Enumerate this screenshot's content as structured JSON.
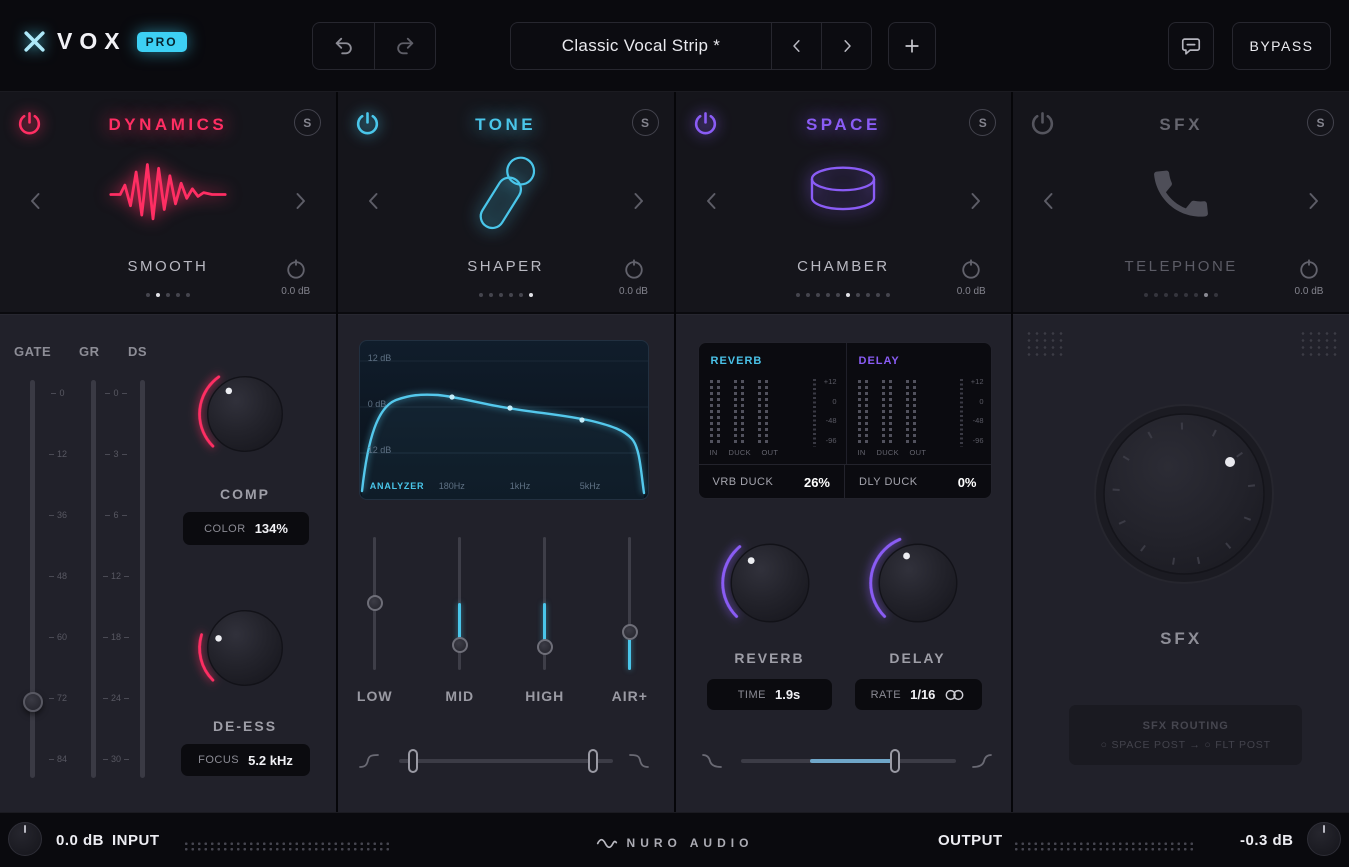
{
  "header": {
    "brand": "VOX",
    "badge": "PRO",
    "preset_name": "Classic Vocal Strip *",
    "bypass_label": "BYPASS"
  },
  "solo_label": "S",
  "modules": [
    {
      "title": "DYNAMICS",
      "preset": "SMOOTH",
      "gain": "0.0 dB",
      "accent": "#ff2e63",
      "dots": {
        "count": 5,
        "active": 1
      }
    },
    {
      "title": "TONE",
      "preset": "SHAPER",
      "gain": "0.0 dB",
      "accent": "#4ac6ea",
      "dots": {
        "count": 6,
        "active": 5
      }
    },
    {
      "title": "SPACE",
      "preset": "CHAMBER",
      "gain": "0.0 dB",
      "accent": "#8a5cf5",
      "dots": {
        "count": 10,
        "active": 5
      }
    },
    {
      "title": "SFX",
      "preset": "TELEPHONE",
      "gain": "0.0 dB",
      "accent": "#6f6f79",
      "dots": {
        "count": 8,
        "active": 6
      }
    }
  ],
  "dynamics": {
    "meter_labels": [
      "GATE",
      "GR",
      "DS"
    ],
    "gate_scale": [
      "0",
      "12",
      "36",
      "48",
      "60",
      "72",
      "84"
    ],
    "grds_scale": [
      "0",
      "3",
      "6",
      "12",
      "18",
      "24",
      "30"
    ],
    "comp_label": "COMP",
    "color": {
      "label": "COLOR",
      "value": "134%"
    },
    "deess_label": "DE-ESS",
    "focus": {
      "label": "FOCUS",
      "value": "5.2 kHz"
    }
  },
  "tone": {
    "db_labels": [
      "12 dB",
      "0 dB",
      "12 dB"
    ],
    "analyzer_label": "ANALYZER",
    "freq_labels": [
      "180Hz",
      "1kHz",
      "5kHz"
    ],
    "slider_labels": [
      "LOW",
      "MID",
      "HIGH",
      "AIR+"
    ]
  },
  "space": {
    "reverb_title": "REVERB",
    "delay_title": "DELAY",
    "meter_labels": [
      "IN",
      "DUCK",
      "OUT"
    ],
    "scale": [
      "+12",
      "0",
      "-48",
      "-96"
    ],
    "vrb_duck": {
      "label": "VRB DUCK",
      "value": "26%"
    },
    "dly_duck": {
      "label": "DLY DUCK",
      "value": "0%"
    },
    "reverb_knob_label": "REVERB",
    "delay_knob_label": "DELAY",
    "time": {
      "label": "TIME",
      "value": "1.9s"
    },
    "rate": {
      "label": "RATE",
      "value": "1/16"
    }
  },
  "sfx": {
    "knob_label": "SFX",
    "routing_label": "SFX ROUTING",
    "routing_value": "○ SPACE POST → ○ FLT POST"
  },
  "footer": {
    "input_value": "0.0 dB",
    "input_label": "INPUT",
    "brand": "NURO AUDIO",
    "output_label": "OUTPUT",
    "output_value": "-0.3 dB"
  }
}
